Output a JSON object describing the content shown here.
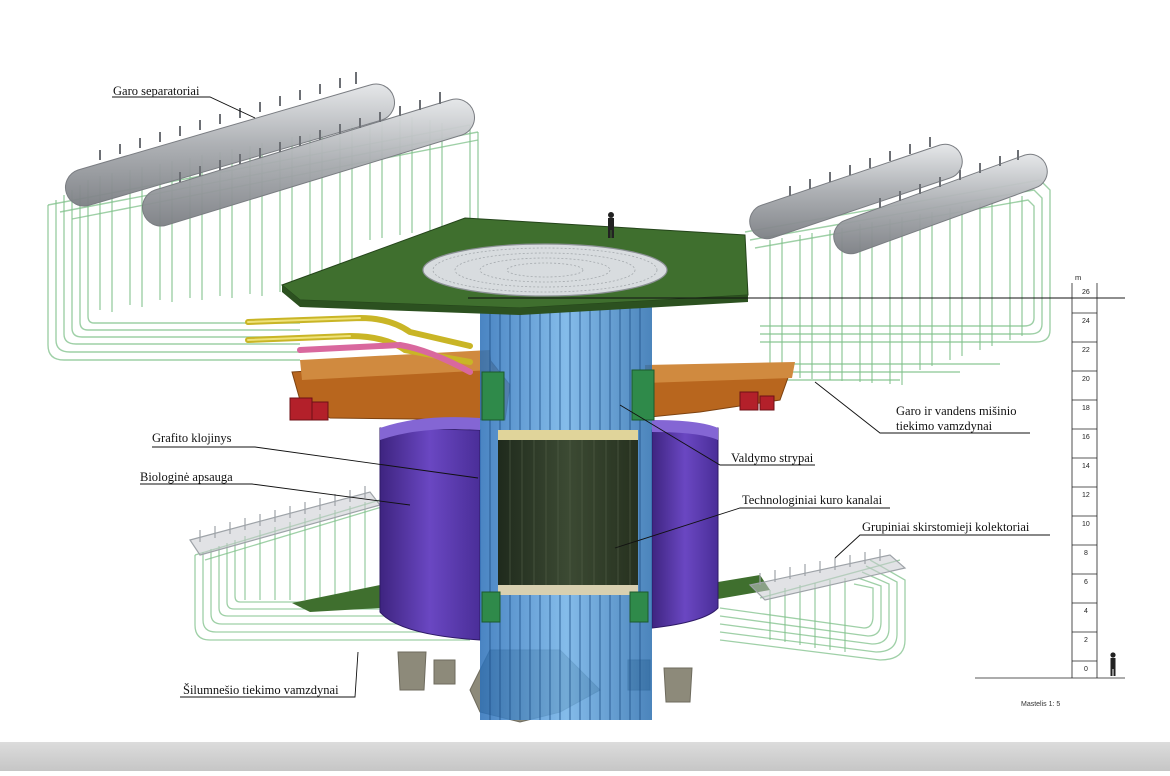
{
  "labels": {
    "garo_separatoriai": "Garo separatoriai",
    "garo_vandens_1": "Garo ir vandens mišinio",
    "garo_vandens_2": "tiekimo vamzdynai",
    "grafito_klojinys": "Grafito klojinys",
    "valdymo_strypai": "Valdymo strypai",
    "biologine_apsauga": "Biologinė apsauga",
    "technologiniai_kanalai": "Technologiniai kuro kanalai",
    "grupiniai_kolektoriai": "Grupiniai skirstomieji kolektoriai",
    "silumnesio": "Šilumnešio tiekimo vamzdynai"
  },
  "scale": {
    "unit": "m",
    "ticks": [
      "26",
      "24",
      "22",
      "20",
      "18",
      "16",
      "14",
      "12",
      "10",
      "8",
      "6",
      "4",
      "2",
      "0"
    ],
    "note": "Mastelis 1: 5"
  },
  "colors": {
    "pipes_green": "#7fc08a",
    "deck_green": "#3f6f2e",
    "shield_purple": "#5a3aa8",
    "support_orange": "#b8661e",
    "graphite_dark": "#2e3a2a",
    "channels_blue": "#3a7fc4",
    "separator_gray": "#a9acb0",
    "concrete_gray": "#8d8a7a"
  }
}
